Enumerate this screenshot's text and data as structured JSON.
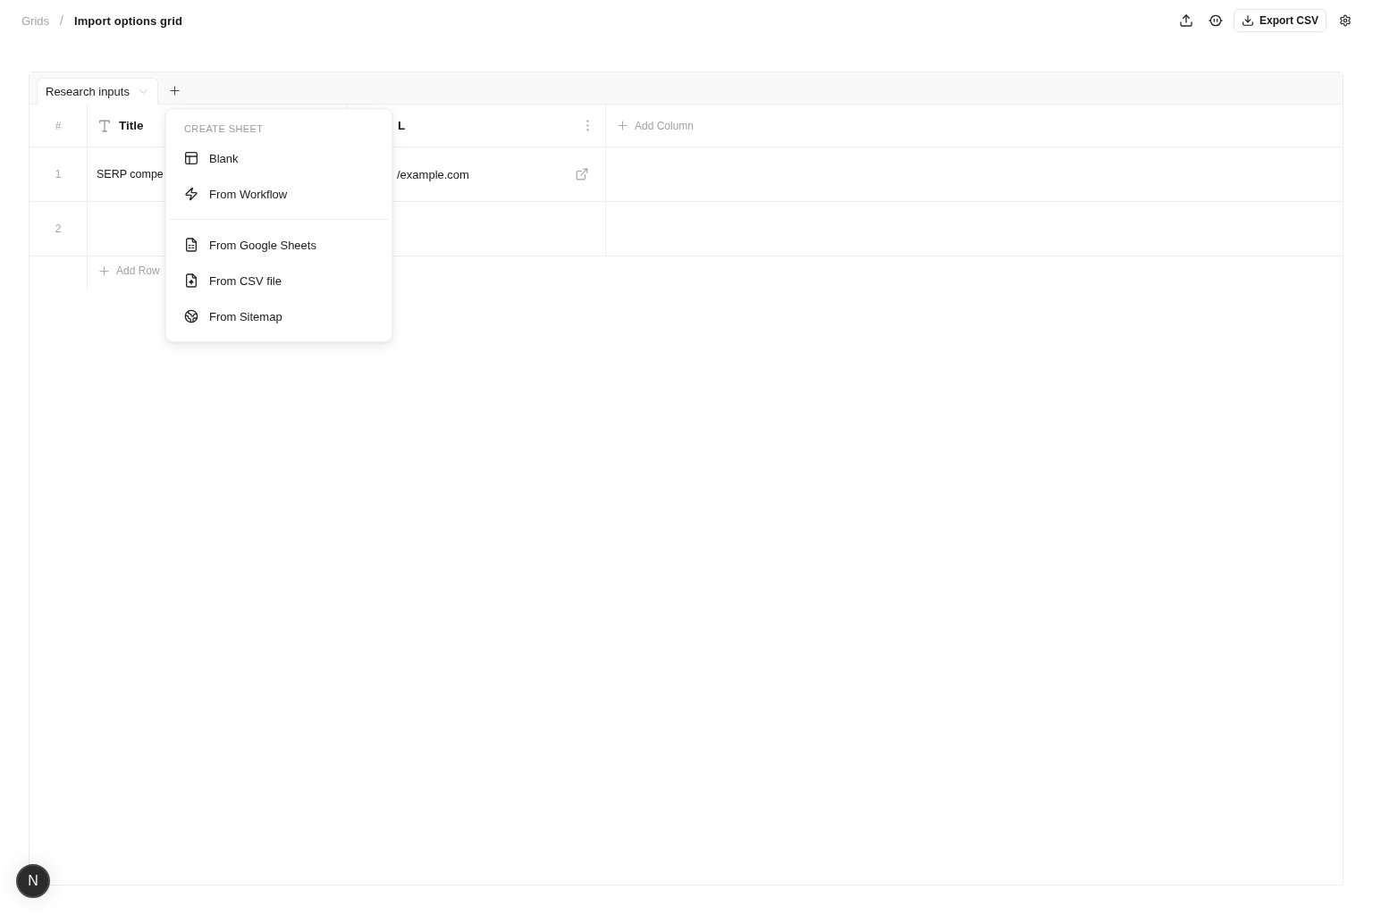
{
  "breadcrumb": {
    "parent": "Grids",
    "separator": "/",
    "current": "Import options grid"
  },
  "toolbar": {
    "export_button": "Export CSV"
  },
  "sheet_tabs": [
    {
      "label": "Research inputs",
      "selected": true
    }
  ],
  "table": {
    "row_number_header": "#",
    "columns": [
      {
        "header": "Title",
        "kind": "text"
      },
      {
        "header": "L",
        "kind": "url"
      }
    ],
    "add_column": "Add Column",
    "rows": [
      {
        "number": "1",
        "cells": [
          "SERP compe",
          "/example.com"
        ]
      },
      {
        "number": "2"
      }
    ],
    "add_row": "Add Row"
  },
  "create_sheet_menu": {
    "heading": "CREATE SHEET",
    "groups": [
      [
        {
          "label": "Blank"
        },
        {
          "label": "From Workflow"
        }
      ],
      [
        {
          "label": "From Google Sheets"
        },
        {
          "label": "From CSV file"
        },
        {
          "label": "From Sitemap"
        }
      ]
    ]
  },
  "dev_badge": {
    "label": "N"
  }
}
